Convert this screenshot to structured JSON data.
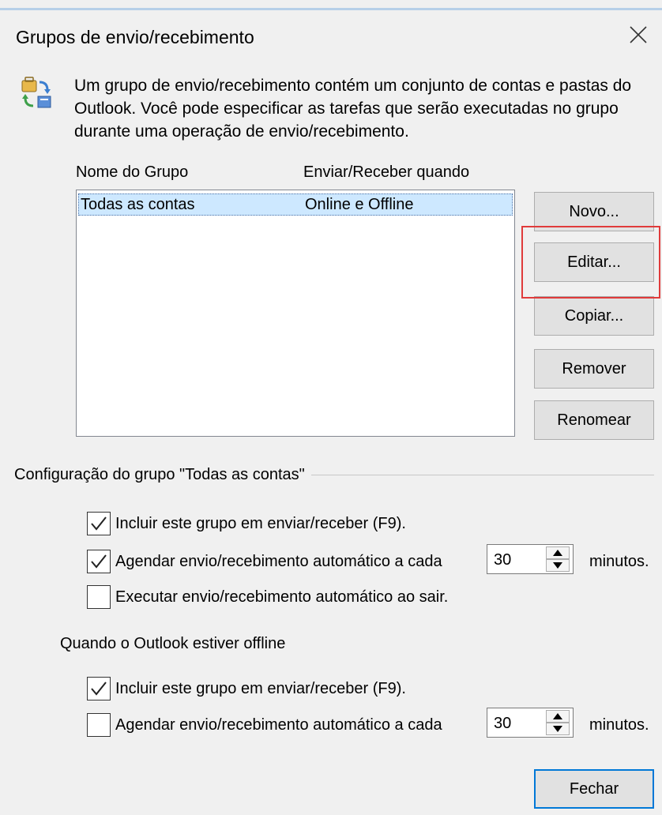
{
  "dialog": {
    "title": "Grupos de envio/recebimento",
    "intro": "Um grupo de envio/recebimento contém um conjunto de contas e pastas do Outlook. Você pode especificar as tarefas que serão executadas no grupo durante uma operação de envio/recebimento."
  },
  "list": {
    "headers": [
      "Nome do Grupo",
      "Enviar/Receber quando"
    ],
    "rows": [
      {
        "name": "Todas as contas",
        "when": "Online e Offline"
      }
    ]
  },
  "buttons": {
    "new": "Novo...",
    "edit": "Editar...",
    "copy": "Copiar...",
    "remove": "Remover",
    "rename": "Renomear",
    "close": "Fechar"
  },
  "settings": {
    "section_title": "Configuração do grupo \"Todas as contas\"",
    "online": {
      "include": {
        "label": "Incluir este grupo em enviar/receber (F9).",
        "checked": true
      },
      "schedule": {
        "label": "Agendar envio/recebimento automático a cada",
        "checked": true,
        "value": "30",
        "unit": "minutos."
      },
      "on_exit": {
        "label": "Executar envio/recebimento automático ao sair.",
        "checked": false
      }
    },
    "offline_title": "Quando o Outlook estiver offline",
    "offline": {
      "include": {
        "label": "Incluir este grupo em enviar/receber (F9).",
        "checked": true
      },
      "schedule": {
        "label": "Agendar envio/recebimento automático a cada",
        "checked": false,
        "value": "30",
        "unit": "minutos."
      }
    }
  },
  "icons": {
    "app": "send-receive-groups-icon",
    "close": "close-icon",
    "check": "checkmark-icon",
    "up": "spin-up-icon",
    "down": "spin-down-icon"
  },
  "colors": {
    "selection": "#cde8ff",
    "highlight_box": "#e03b3b",
    "default_button_border": "#0078d7"
  }
}
